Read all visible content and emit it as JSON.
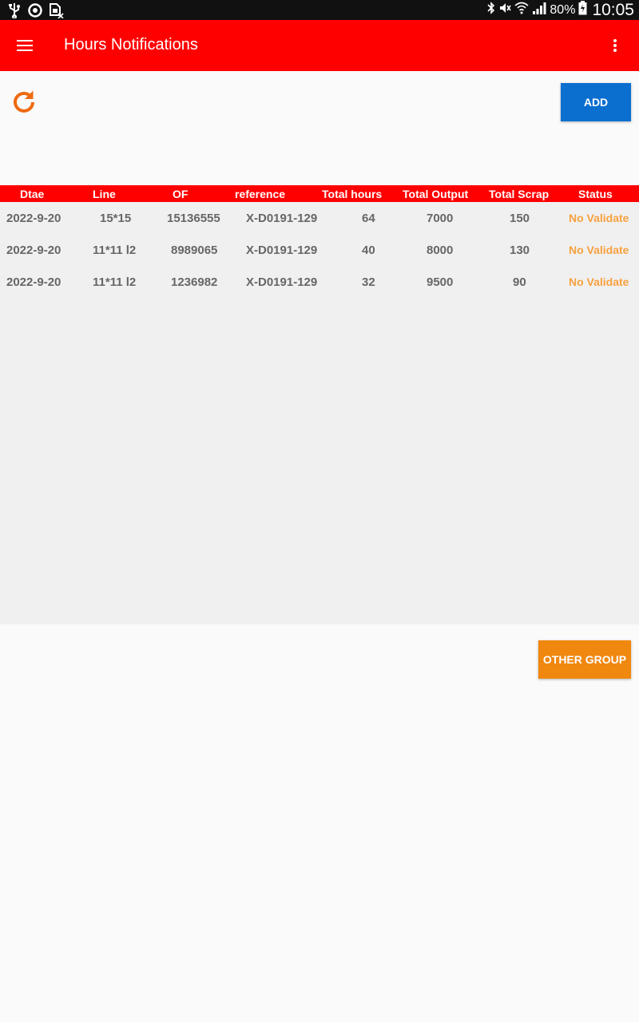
{
  "status_bar": {
    "icons_left": [
      "usb-icon",
      "sync-icon",
      "sim-error-icon"
    ],
    "icons_right": [
      "bluetooth-icon",
      "mute-icon",
      "wifi-icon",
      "signal-icon",
      "battery-icon"
    ],
    "battery": "80%",
    "time": "10:05"
  },
  "app_bar": {
    "title": "Hours Notifications",
    "color": "#ff0000",
    "menu_icon": "hamburger-menu-icon",
    "overflow_icon": "more-vert-icon"
  },
  "toolbar": {
    "refresh_icon": "refresh-icon",
    "add_label": "ADD",
    "add_color": "#0b6fd0"
  },
  "table": {
    "headers": [
      "Dtae",
      "Line",
      "OF",
      "reference",
      "Total hours",
      "Total Output",
      "Total Scrap",
      "Status"
    ],
    "rows": [
      {
        "date": "2022-9-20",
        "line": "15*15",
        "of": "15136555",
        "reference": "X-D0191-129",
        "total_hours": "64",
        "total_output": "7000",
        "total_scrap": "150",
        "status": "No Validate"
      },
      {
        "date": "2022-9-20",
        "line": "11*11 l2",
        "of": "8989065",
        "reference": "X-D0191-129",
        "total_hours": "40",
        "total_output": "8000",
        "total_scrap": "130",
        "status": "No Validate"
      },
      {
        "date": "2022-9-20",
        "line": "11*11 l2",
        "of": "1236982",
        "reference": "X-D0191-129",
        "total_hours": "32",
        "total_output": "9500",
        "total_scrap": "90",
        "status": "No Validate"
      }
    ],
    "status_color": "#f7a13f"
  },
  "footer": {
    "other_group_label": "OTHER GROUP",
    "other_group_color": "#f0870e"
  }
}
